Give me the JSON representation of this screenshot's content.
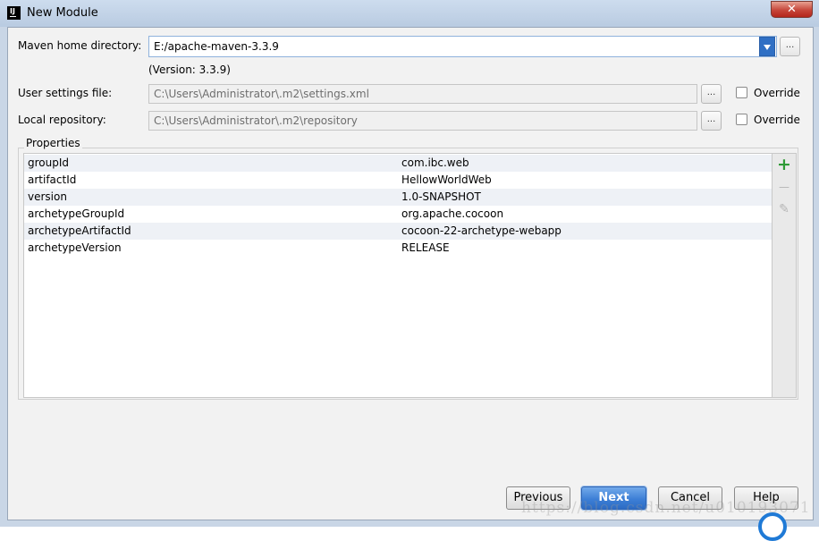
{
  "window": {
    "title": "New Module",
    "close_glyph": "✕"
  },
  "maven_home": {
    "label": "Maven home directory:",
    "value": "E:/apache-maven-3.3.9",
    "version_note": "(Version: 3.3.9)",
    "browse_label": "..."
  },
  "user_settings": {
    "label": "User settings file:",
    "value": "C:\\Users\\Administrator\\.m2\\settings.xml",
    "browse_label": "...",
    "override_label": "Override",
    "override_checked": false
  },
  "local_repository": {
    "label": "Local repository:",
    "value": "C:\\Users\\Administrator\\.m2\\repository",
    "browse_label": "...",
    "override_label": "Override",
    "override_checked": false
  },
  "properties": {
    "title": "Properties",
    "rows": [
      {
        "name": "groupId",
        "value": "com.ibc.web"
      },
      {
        "name": "artifactId",
        "value": "HellowWorldWeb"
      },
      {
        "name": "version",
        "value": "1.0-SNAPSHOT"
      },
      {
        "name": "archetypeGroupId",
        "value": "org.apache.cocoon"
      },
      {
        "name": "archetypeArtifactId",
        "value": "cocoon-22-archetype-webapp"
      },
      {
        "name": "archetypeVersion",
        "value": "RELEASE"
      }
    ],
    "toolbar": {
      "add_glyph": "+",
      "remove_glyph": "—",
      "edit_glyph": "✎"
    }
  },
  "buttons": {
    "previous": "Previous",
    "next": "Next",
    "cancel": "Cancel",
    "help": "Help"
  },
  "watermark": {
    "text": "https://blog.csdn.net/u010193071"
  },
  "colors": {
    "accent": "#3d7fd6",
    "add_green": "#2e9a36",
    "close_red": "#c6463a"
  }
}
